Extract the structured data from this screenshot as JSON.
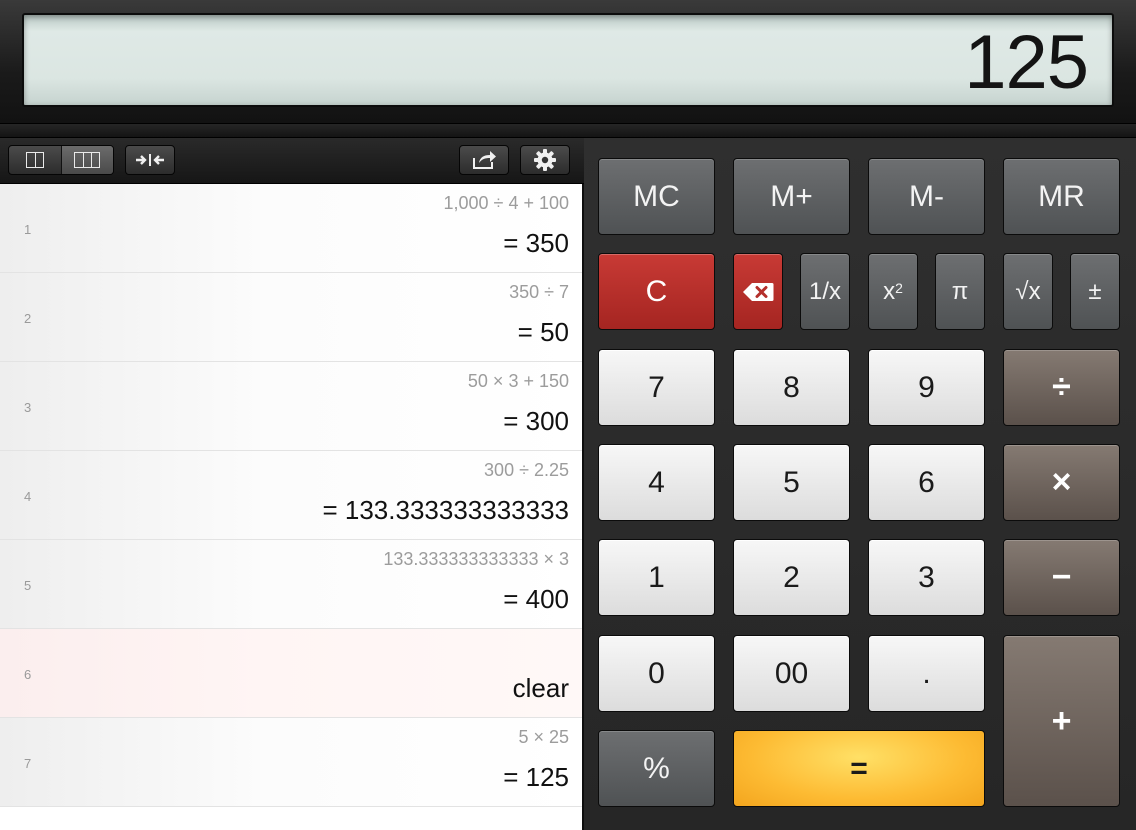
{
  "display": {
    "value": "125"
  },
  "history_toolbar": {
    "layout_icons": [
      "two-column-layout-icon",
      "three-column-layout-icon"
    ],
    "collapse_icon": "collapse-arrows-icon",
    "share_icon": "share-icon",
    "settings_icon": "gear-icon"
  },
  "history": [
    {
      "num": "1",
      "expr": "1,000 ÷ 4 + 100",
      "result": "= 350"
    },
    {
      "num": "2",
      "expr": "350 ÷ 7",
      "result": "= 50"
    },
    {
      "num": "3",
      "expr": "50 × 3 + 150",
      "result": "= 300"
    },
    {
      "num": "4",
      "expr": "300 ÷ 2.25",
      "result": "= 133.333333333333"
    },
    {
      "num": "5",
      "expr": "133.333333333333 × 3",
      "result": "= 400"
    },
    {
      "num": "6",
      "expr": "",
      "result": "clear"
    },
    {
      "num": "7",
      "expr": "5 × 25",
      "result": "= 125"
    }
  ],
  "keys": {
    "mc": "MC",
    "mplus": "M+",
    "mminus": "M-",
    "mr": "MR",
    "clear": "C",
    "reciprocal": "1/x",
    "square": "x",
    "square_exp": "2",
    "pi": "π",
    "sqrt": "√x",
    "sign": "±",
    "seven": "7",
    "eight": "8",
    "nine": "9",
    "divide": "÷",
    "four": "4",
    "five": "5",
    "six": "6",
    "multiply": "×",
    "one": "1",
    "two": "2",
    "three": "3",
    "minus": "−",
    "zero": "0",
    "double_zero": "00",
    "dot": ".",
    "plus": "+",
    "percent": "%",
    "equals": "="
  },
  "colors": {
    "clear_key": "#b42f2b",
    "equals_key": "#fdbb33",
    "operator_key": "#6f655e"
  }
}
